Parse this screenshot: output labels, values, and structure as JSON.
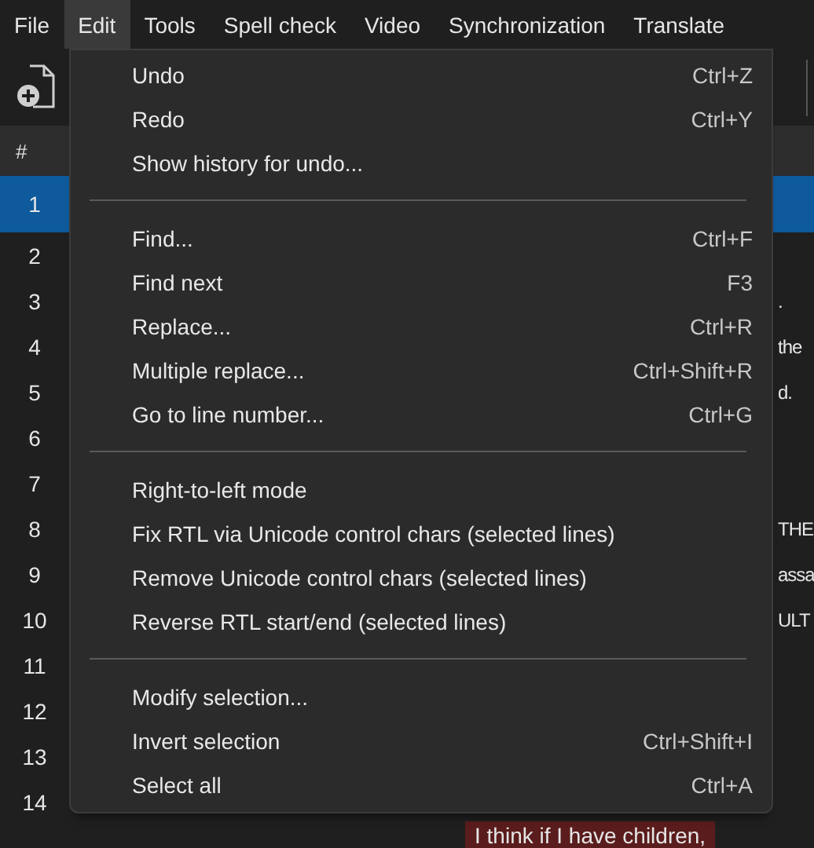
{
  "menu_bar": [
    {
      "label": "File",
      "selected": false
    },
    {
      "label": "Edit",
      "selected": true
    },
    {
      "label": "Tools",
      "selected": false
    },
    {
      "label": "Spell check",
      "selected": false
    },
    {
      "label": "Video",
      "selected": false
    },
    {
      "label": "Synchronization",
      "selected": false
    },
    {
      "label": "Translate",
      "selected": false
    }
  ],
  "grid": {
    "header": "#",
    "rows": [
      {
        "number": "1",
        "selected": true,
        "error": false
      },
      {
        "number": "2",
        "selected": false,
        "error": false
      },
      {
        "number": "3",
        "text": ".",
        "selected": false,
        "error": false
      },
      {
        "number": "4",
        "text": "the",
        "selected": false,
        "error": false
      },
      {
        "number": "5",
        "text": "d.",
        "selected": false,
        "error": false
      },
      {
        "number": "6",
        "selected": false,
        "error": false
      },
      {
        "number": "7",
        "selected": false,
        "error": false
      },
      {
        "number": "8",
        "text": "THE",
        "selected": false,
        "error": false
      },
      {
        "number": "9",
        "text": "assa",
        "selected": false,
        "error": false
      },
      {
        "number": "10",
        "text": "ULT",
        "selected": false,
        "error": false
      },
      {
        "number": "11",
        "selected": false,
        "error": false
      },
      {
        "number": "12",
        "selected": false,
        "error": false
      },
      {
        "number": "13",
        "selected": false,
        "error": false
      },
      {
        "number": "14",
        "selected": false,
        "error": false
      },
      {
        "text": "I think if I have children,",
        "selected": false,
        "error": true
      }
    ]
  },
  "edit_menu": [
    {
      "kind": "item",
      "label": "Undo",
      "shortcut": "Ctrl+Z"
    },
    {
      "kind": "item",
      "label": "Redo",
      "shortcut": "Ctrl+Y"
    },
    {
      "kind": "item",
      "label": "Show history for undo..."
    },
    {
      "kind": "separator"
    },
    {
      "kind": "item",
      "label": "Find...",
      "shortcut": "Ctrl+F"
    },
    {
      "kind": "item",
      "label": "Find next",
      "shortcut": "F3"
    },
    {
      "kind": "item",
      "label": "Replace...",
      "shortcut": "Ctrl+R"
    },
    {
      "kind": "item",
      "label": "Multiple replace...",
      "shortcut": "Ctrl+Shift+R"
    },
    {
      "kind": "item",
      "label": "Go to line number...",
      "shortcut": "Ctrl+G"
    },
    {
      "kind": "separator"
    },
    {
      "kind": "item",
      "label": "Right-to-left mode"
    },
    {
      "kind": "item",
      "label": "Fix RTL via Unicode control chars (selected lines)"
    },
    {
      "kind": "item",
      "label": "Remove Unicode control chars (selected lines)"
    },
    {
      "kind": "item",
      "label": "Reverse RTL start/end (selected lines)"
    },
    {
      "kind": "separator"
    },
    {
      "kind": "item",
      "label": "Modify selection..."
    },
    {
      "kind": "item",
      "label": "Invert selection",
      "shortcut": "Ctrl+Shift+I"
    },
    {
      "kind": "item",
      "label": "Select all",
      "shortcut": "Ctrl+A"
    }
  ]
}
